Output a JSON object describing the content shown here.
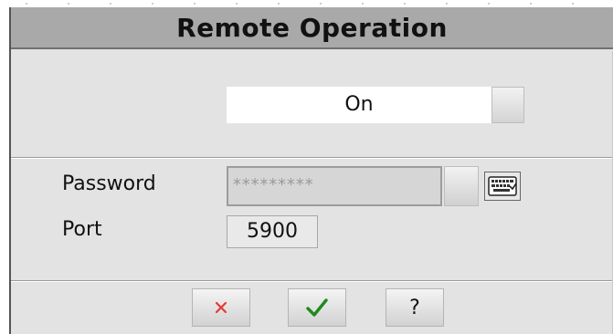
{
  "dialog": {
    "title": "Remote Operation"
  },
  "remote": {
    "value": "On",
    "toggle_icon": "dropdown-button"
  },
  "password": {
    "label": "Password",
    "masked_value": "*********",
    "keyboard_icon": "keyboard-icon"
  },
  "port": {
    "label": "Port",
    "value": "5900"
  },
  "buttons": {
    "cancel_icon": "close-icon",
    "cancel_color": "#e53935",
    "ok_icon": "check-icon",
    "ok_color": "#1e8a1e",
    "help_label": "?"
  }
}
